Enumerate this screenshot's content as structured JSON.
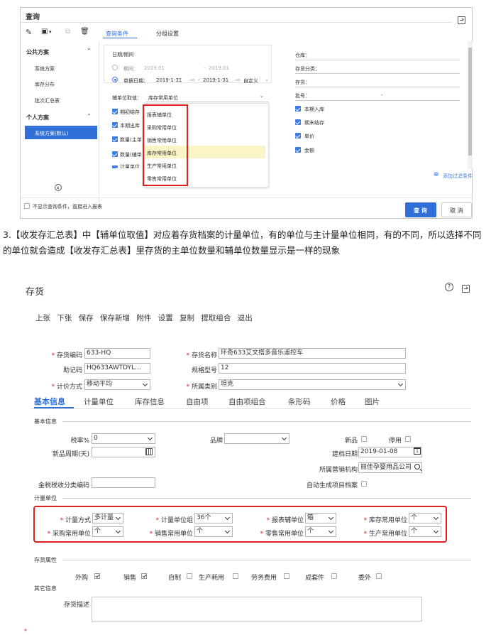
{
  "query": {
    "title": "查询",
    "tabs": [
      "查询条件",
      "分组设置"
    ],
    "public_header": "公共方案",
    "public_items": [
      "系统方案",
      "库存分布",
      "批次汇总表"
    ],
    "personal_header": "个人方案",
    "personal_items": [
      "系统方案(默认)"
    ],
    "date_section": "日期/期间",
    "period_label": "期间：",
    "period_from": "2019.01",
    "period_sep": "-",
    "period_to": "2019.01",
    "docdate_label": "单据日期：",
    "docdate_from": "2019-1-31",
    "docdate_sep": "-",
    "docdate_to": "2019-1-31",
    "custom_label": "自定义",
    "aux_unit_label": "辅单位取值：",
    "aux_unit_value": "库存常用单位",
    "left_checks": [
      "期初结存",
      "本期出库",
      "数量(主单",
      "数量(辅单",
      "计量单位"
    ],
    "dropdown_options": [
      "报表辅单位",
      "采购常用单位",
      "销售常用单位",
      "库存常用单位",
      "生产常用单位",
      "零售常用单位"
    ],
    "right_fields": [
      "仓库：",
      "存货分类：",
      "存货：",
      "批号："
    ],
    "batch_dash": "-",
    "right_checks": [
      "本期入库",
      "期末结存",
      "单价",
      "金额"
    ],
    "add_filter": "添加过滤条件",
    "footer_check": "不显示查询条件，直接进入报表",
    "query_btn": "查 询",
    "cancel_btn": "取 消"
  },
  "paragraph": "3.【收发存汇总表】中【辅单位取值】对应着存货档案的计量单位，有的单位与主计量单位相同，有的不同，所以选择不同的单位就会造成【收发存汇总表】里存货的主单位数量和辅单位数量显示是一样的现象",
  "inventory": {
    "title": "存货",
    "toolbar": [
      "上张",
      "下张",
      "保存",
      "保存新增",
      "附件",
      "设置",
      "复制",
      "提取组合",
      "退出"
    ],
    "code_label": "存货编码",
    "code_value": "633-HQ",
    "name_label": "存货名称",
    "name_value": "环奇633艾文搭多音乐遥控车",
    "mnemonic_label": "助记码",
    "mnemonic_value": "HQ633AWTDYL...",
    "spec_label": "规格型号",
    "spec_value": "12",
    "pricing_label": "计价方式",
    "pricing_value": "移动平均",
    "category_label": "所属类别",
    "category_value": "坦克",
    "tabs": [
      "基本信息",
      "计量单位",
      "库存信息",
      "自由项",
      "自由项组合",
      "条形码",
      "价格",
      "图片"
    ],
    "basic_section": "基本信息",
    "tax_label": "税率%",
    "tax_value": "0",
    "brand_label": "品牌",
    "new_label": "新品",
    "disabled_label": "停用",
    "newcycle_label": "新品周期(天)",
    "builddate_label": "建档日期",
    "builddate_value": "2019-01-08",
    "org_label": "所属营销机构",
    "org_value": "丽佳孕婴用品公司",
    "taxcode_label": "金税税收分类编码",
    "autogen_label": "自动生成项目档案",
    "unit_section": "计量单位",
    "unit_fields": [
      {
        "label": "计量方式",
        "value": "多计量"
      },
      {
        "label": "计量单位组",
        "value": "36个"
      },
      {
        "label": "报表辅单位",
        "value": "箱"
      },
      {
        "label": "库存常用单位",
        "value": "个"
      },
      {
        "label": "采购常用单位",
        "value": "个"
      },
      {
        "label": "销售常用单位",
        "value": "个"
      },
      {
        "label": "零售常用单位",
        "value": "个"
      },
      {
        "label": "生产常用单位",
        "value": "个"
      }
    ],
    "attr_section": "存货属性",
    "attrs": [
      "外购",
      "销售",
      "自制",
      "生产耗用",
      "劳务费用",
      "成套件",
      "委外"
    ],
    "other_section": "其它信息",
    "desc_label": "存货描述"
  },
  "colors": {
    "accent": "#3b7be8",
    "highlight": "#e02020",
    "selected": "#fbf4c6",
    "sidebar_selected": "#2f6fd6"
  }
}
